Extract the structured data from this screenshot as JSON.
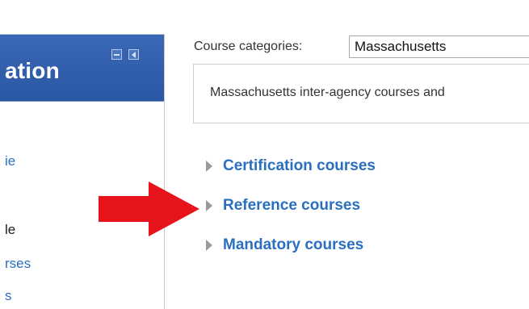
{
  "nav": {
    "title": "ation",
    "items": [
      {
        "label": "ie",
        "kind": "link"
      },
      {
        "label": "le",
        "kind": "plain"
      },
      {
        "label": "rses",
        "kind": "link"
      },
      {
        "label": "s",
        "kind": "link"
      }
    ]
  },
  "categories": {
    "label": "Course categories:",
    "selected": "Massachusetts",
    "description": "Massachusetts inter-agency courses and"
  },
  "courses": [
    {
      "label": "Certification courses"
    },
    {
      "label": "Reference courses"
    },
    {
      "label": "Mandatory courses"
    }
  ],
  "colors": {
    "header": "#2f5eab",
    "link": "#2a6fbf",
    "arrow": "#e8141b"
  },
  "icons": [
    "minimize-icon",
    "dock-icon",
    "expand-triangle-icon",
    "red-arrow"
  ]
}
